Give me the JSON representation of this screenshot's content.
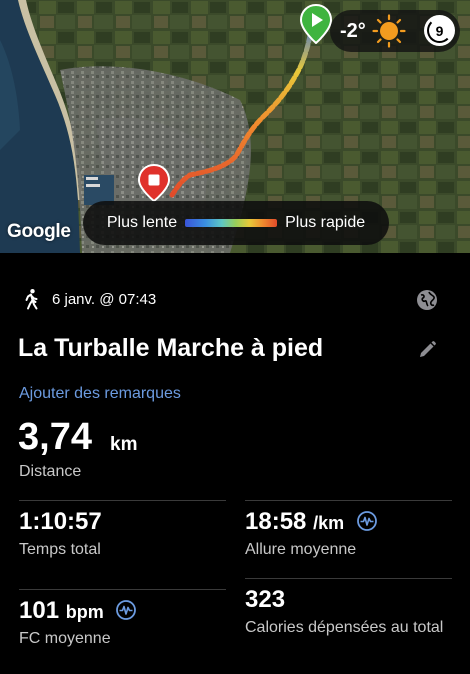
{
  "map": {
    "weather": {
      "temperature": "-2°",
      "condition_icon": "sun-icon",
      "uv_index": "9"
    },
    "provider_label": "Google",
    "legend": {
      "slow_label": "Plus lente",
      "fast_label": "Plus rapide"
    },
    "colors": {
      "slow": "#3a54d8",
      "fast": "#e24b2a",
      "start_pin": "#3fb43f",
      "end_pin": "#e0312b"
    }
  },
  "activity": {
    "type_icon": "walking-icon",
    "date_time": "6 janv. @ 07:43",
    "visibility_icon": "globe-icon",
    "title": "La Turballe Marche à pied",
    "add_notes_label": "Ajouter des remarques",
    "distance": {
      "value": "3,74",
      "unit": "km",
      "label": "Distance"
    }
  },
  "stats": [
    {
      "value": "1:10:57",
      "unit": "",
      "label": "Temps total"
    },
    {
      "value": "18:58",
      "unit": "/km",
      "label": "Allure moyenne"
    },
    {
      "value": "101",
      "unit": "bpm",
      "label": "FC moyenne"
    },
    {
      "value": "323",
      "unit": "",
      "label": "Calories dépensées au total"
    }
  ],
  "accent_color": "#6c9be0"
}
